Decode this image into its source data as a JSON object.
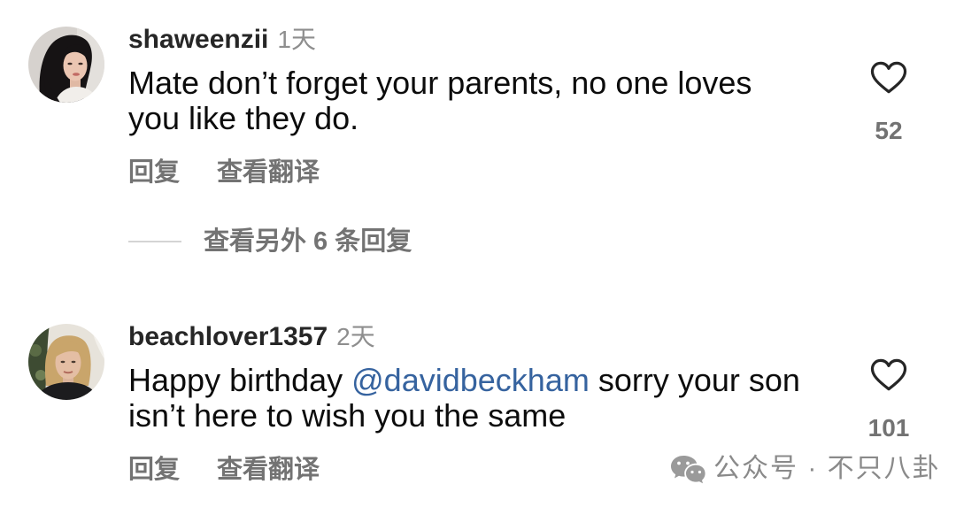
{
  "comments": [
    {
      "username": "shaweenzii",
      "time": "1天",
      "text": {
        "line1": "Mate don’t forget your parents, no one loves",
        "line2": "you like they do."
      },
      "like_icon": "heart-outline-icon",
      "likes": "52",
      "actions": {
        "reply": "回复",
        "translate": "查看翻译"
      }
    },
    {
      "username": "beachlover1357",
      "time": "2天",
      "text": {
        "line1_before": "Happy birthday ",
        "mention": "@davidbeckham",
        "line1_after": " sorry your son",
        "line2": "isn’t here to wish you the same"
      },
      "like_icon": "heart-outline-icon",
      "likes": "101",
      "actions": {
        "reply": "回复",
        "translate": "查看翻译"
      }
    }
  ],
  "view_more_replies": "查看另外 6 条回复",
  "watermark": {
    "icon": "wechat-icon",
    "text": "公众号 · 不只八卦"
  },
  "colors": {
    "text": "#0c0c0c",
    "username": "#262626",
    "muted": "#8e8e8e",
    "action": "#737373",
    "mention": "#36639f",
    "heart": "#262626",
    "divider": "#d4d4d4",
    "watermark": "#8a8a8a",
    "watermark_icon": "#9a9a9a"
  }
}
